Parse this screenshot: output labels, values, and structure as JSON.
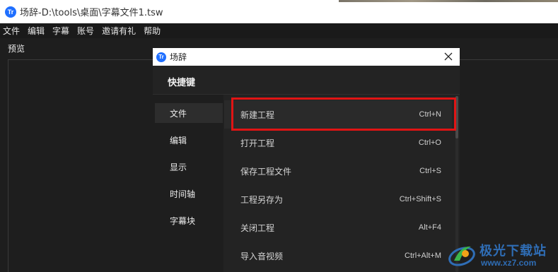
{
  "window": {
    "title": "场辞-D:\\tools\\桌面\\字幕文件1.tsw",
    "logo_text": "Tr"
  },
  "menubar": {
    "items": [
      "文件",
      "编辑",
      "字幕",
      "账号",
      "邀请有礼",
      "帮助"
    ]
  },
  "preview": {
    "label": "预览"
  },
  "dialog": {
    "title": "场辞",
    "logo_text": "Tr",
    "heading": "快捷键",
    "categories": [
      "文件",
      "编辑",
      "显示",
      "时间轴",
      "字幕块"
    ],
    "active_category": "文件",
    "shortcuts": [
      {
        "name": "新建工程",
        "key": "Ctrl+N"
      },
      {
        "name": "打开工程",
        "key": "Ctrl+O"
      },
      {
        "name": "保存工程文件",
        "key": "Ctrl+S"
      },
      {
        "name": "工程另存为",
        "key": "Ctrl+Shift+S"
      },
      {
        "name": "关闭工程",
        "key": "Alt+F4"
      },
      {
        "name": "导入音视频",
        "key": "Ctrl+Alt+M"
      }
    ]
  },
  "watermark": {
    "brand": "极光下载站",
    "url": "www.xz7.com"
  },
  "colors": {
    "accent": "#1f6fff",
    "highlight": "#e01414",
    "watermark": "#2f6db5"
  }
}
